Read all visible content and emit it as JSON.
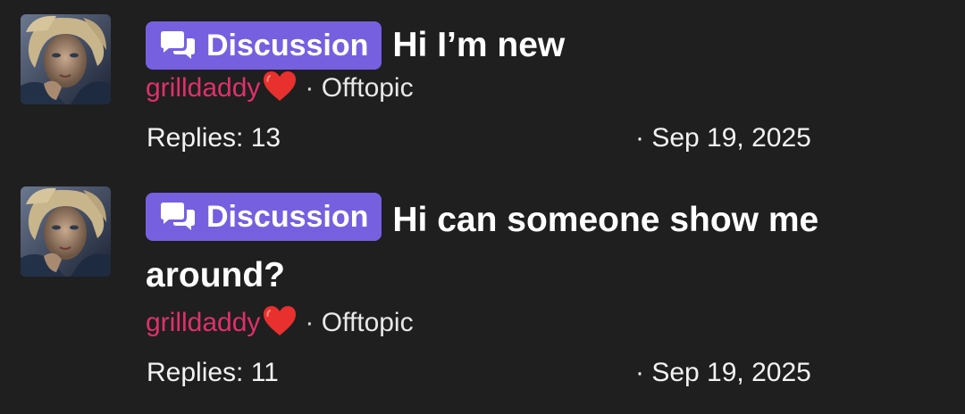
{
  "threads": [
    {
      "prefix": "Discussion",
      "title": "Hi I’m new",
      "author": "grilldaddy",
      "separator": "·",
      "forum": "Offtopic",
      "replies": "Replies: 13",
      "date": "· Sep 19, 2025",
      "avatar_icon": "user-avatar",
      "prefix_icon": "chat-bubbles-icon",
      "author_icon": "heart-icon"
    },
    {
      "prefix": "Discussion",
      "title": "Hi can someone show me around?",
      "author": "grilldaddy",
      "separator": "·",
      "forum": "Offtopic",
      "replies": "Replies: 11",
      "date": "· Sep 19, 2025",
      "avatar_icon": "user-avatar",
      "prefix_icon": "chat-bubbles-icon",
      "author_icon": "heart-icon"
    }
  ],
  "colors": {
    "background": "#1f1f1f",
    "badge": "#7660e0",
    "author": "#e0306b",
    "heart": "#e8302f",
    "text": "#ffffff"
  }
}
